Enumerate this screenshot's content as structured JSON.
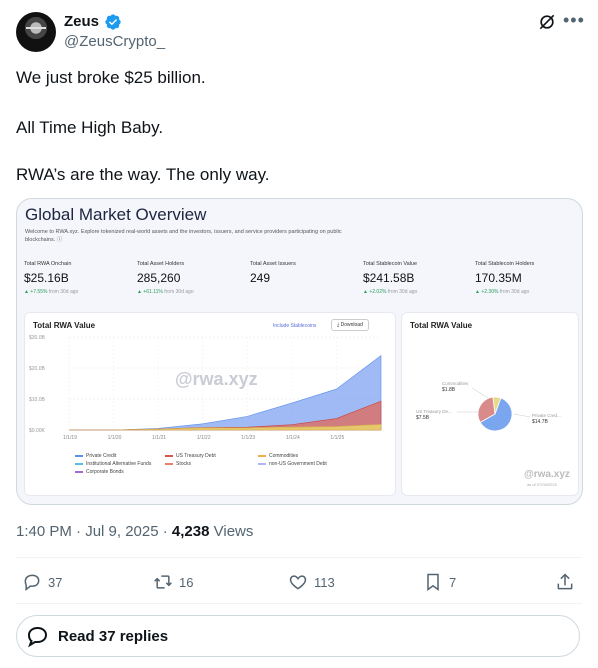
{
  "author": {
    "name": "Zeus",
    "handle": "@ZeusCrypto_"
  },
  "tweet_lines": [
    "We just broke $25 billion.",
    "All Time High Baby.",
    "RWA’s are the way. The only way."
  ],
  "card": {
    "title": "Global Market Overview",
    "description": "Welcome to RWA.xyz. Explore tokenized real-world assets and the investors, issuers, and service providers participating on public blockchains. ⓘ",
    "stats": [
      {
        "label": "Total RWA Onchain",
        "value": "$25.16B",
        "change": "▲ +7.55%",
        "period": "from 30d ago"
      },
      {
        "label": "Total Asset Holders",
        "value": "285,260",
        "change": "▲ +61.11%",
        "period": "from 30d ago"
      },
      {
        "label": "Total Asset Issuers",
        "value": "249",
        "change": "",
        "period": ""
      },
      {
        "label": "Total Stablecoin Value",
        "value": "$241.58B",
        "change": "▲ +2.02%",
        "period": "from 30d ago"
      },
      {
        "label": "Total Stablecoin Holders",
        "value": "170.35M",
        "change": "▲ +2.30%",
        "period": "from 30d ago"
      }
    ],
    "left_panel": {
      "title": "Total RWA Value",
      "include_stablecoins": "Include Stablecoins",
      "download": "Download",
      "watermark": "rwa.xyz",
      "y_ticks": [
        "$30.0B",
        "$20.0B",
        "$10.0B",
        "$0.00K"
      ],
      "x_ticks": [
        "1/1/19",
        "1/1/20",
        "1/1/21",
        "1/1/22",
        "1/1/23",
        "1/1/24",
        "1/1/25"
      ],
      "legend": [
        {
          "label": "Private Credit",
          "color": "#5b8def"
        },
        {
          "label": "US Treasury Debt",
          "color": "#d9534f"
        },
        {
          "label": "Commodities",
          "color": "#f0ad4e"
        },
        {
          "label": "Institutional Alternative Funds",
          "color": "#5bc0de"
        },
        {
          "label": "Stocks",
          "color": "#e8806a"
        },
        {
          "label": "non-US Government Debt",
          "color": "#b0b7ff"
        },
        {
          "label": "Corporate Bonds",
          "color": "#a06bd5"
        }
      ]
    },
    "right_panel": {
      "title": "Total RWA Value",
      "slices": [
        {
          "label": "Private Cred...",
          "value": "$14.7B",
          "color": "#7aa6f0"
        },
        {
          "label": "US Treasury De...",
          "value": "$7.5B",
          "color": "#d98a8a"
        },
        {
          "label": "Commodities",
          "value": "$1.8B",
          "color": "#e8d98a"
        }
      ],
      "watermark": "rwa.xyz",
      "as_of": "as of 07/09/2025"
    }
  },
  "chart_data": [
    {
      "type": "area",
      "title": "Total RWA Value",
      "x": [
        "1/1/19",
        "1/1/20",
        "1/1/21",
        "1/1/22",
        "1/1/23",
        "1/1/24",
        "1/1/25",
        "7/9/25"
      ],
      "series": [
        {
          "name": "Private Credit",
          "values": [
            0,
            0,
            0.2,
            1.2,
            3.5,
            7.0,
            9.5,
            14.7
          ]
        },
        {
          "name": "US Treasury Debt",
          "values": [
            0,
            0,
            0,
            0.1,
            0.2,
            0.8,
            2.6,
            7.5
          ]
        },
        {
          "name": "Commodities",
          "values": [
            0,
            0,
            0.3,
            0.7,
            0.7,
            0.9,
            1.1,
            1.8
          ]
        }
      ],
      "ylim": [
        0,
        30
      ],
      "ylabel_ticks": [
        "$0.00K",
        "$10.0B",
        "$20.0B",
        "$30.0B"
      ]
    },
    {
      "type": "pie",
      "title": "Total RWA Value",
      "labels": [
        "Private Cred...",
        "US Treasury De...",
        "Commodities"
      ],
      "values": [
        14.7,
        7.5,
        1.8
      ]
    }
  ],
  "footer": {
    "time": "1:40 PM · Jul 9, 2025 · ",
    "views_count": "4,238",
    "views_label": " Views",
    "replies": "37",
    "retweets": "16",
    "likes": "113",
    "bookmarks": "7",
    "read_replies": "Read 37 replies"
  }
}
